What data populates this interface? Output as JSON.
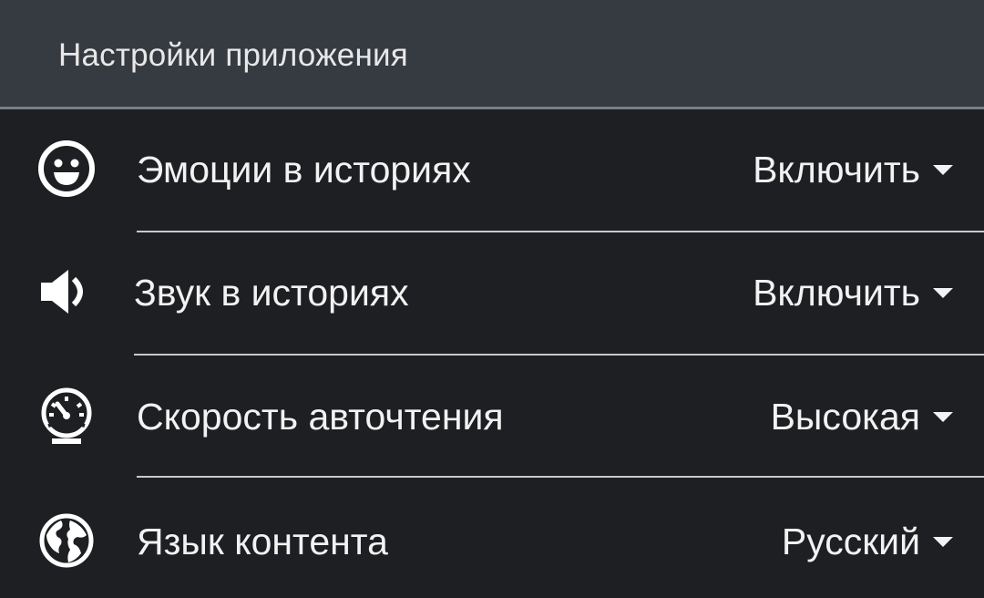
{
  "header": {
    "title": "Настройки приложения"
  },
  "settings": [
    {
      "icon": "smiley-icon",
      "label": "Эмоции в историях",
      "value": "Включить"
    },
    {
      "icon": "speaker-icon",
      "label": "Звук в историях",
      "value": "Включить"
    },
    {
      "icon": "speedometer-icon",
      "label": "Скорость авточтения",
      "value": "Высокая"
    },
    {
      "icon": "globe-icon",
      "label": "Язык контента",
      "value": "Русский"
    }
  ],
  "colors": {
    "header_bg": "#363b42",
    "body_bg": "#1e1f22",
    "text": "#f2f2f2",
    "divider": "#c9c9c9"
  }
}
